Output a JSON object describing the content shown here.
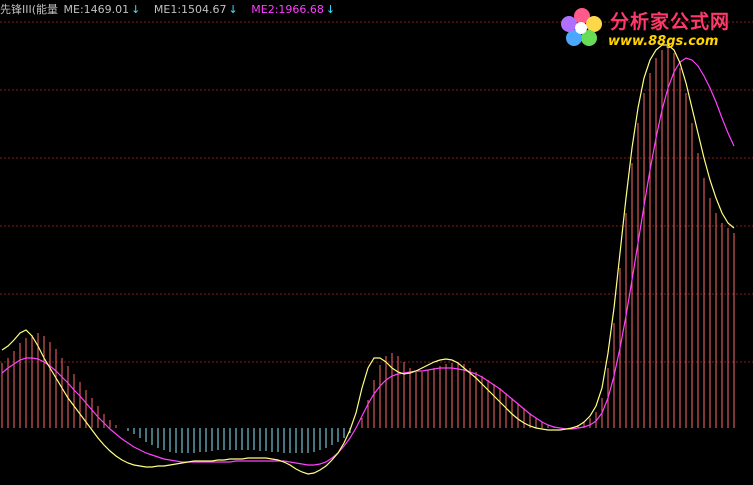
{
  "header": {
    "indicator_name": "先锋III(能量",
    "me_label": "ME:1469.01",
    "me1_label": "ME1:1504.67",
    "me2_label": "ME2:1966.68",
    "arrow": "↓"
  },
  "logo": {
    "title": "分析家公式网",
    "url": "www.88gs.com",
    "icon": "flower-icon"
  },
  "colors": {
    "background": "#000000",
    "grid": "#8a1c1c",
    "bar_positive": "#ff6a6a",
    "bar_negative": "#8fe8ff",
    "line_me1": "#ffff80",
    "line_me2": "#ff40ff"
  },
  "chart_data": {
    "type": "bar",
    "zero_line": 0,
    "grid": true,
    "bars_description": "histogram ME per period, positive red, negative cyan",
    "bars": [
      65,
      70,
      77,
      85,
      90,
      93,
      95,
      92,
      86,
      79,
      70,
      62,
      54,
      46,
      38,
      30,
      22,
      14,
      8,
      3,
      0,
      -3,
      -6,
      -10,
      -14,
      -17,
      -20,
      -22,
      -24,
      -25,
      -25,
      -25,
      -25,
      -24,
      -24,
      -23,
      -22,
      -22,
      -22,
      -22,
      -22,
      -22,
      -22,
      -23,
      -23,
      -24,
      -24,
      -25,
      -25,
      -25,
      -25,
      -25,
      -24,
      -22,
      -20,
      -17,
      -14,
      -10,
      -5,
      0,
      10,
      28,
      48,
      63,
      72,
      75,
      72,
      66,
      60,
      56,
      56,
      58,
      60,
      62,
      64,
      65,
      66,
      64,
      60,
      56,
      52,
      48,
      44,
      40,
      35,
      30,
      25,
      20,
      15,
      10,
      6,
      3,
      1,
      0,
      0,
      1,
      3,
      6,
      10,
      16,
      30,
      60,
      105,
      160,
      215,
      265,
      305,
      335,
      355,
      370,
      378,
      380,
      375,
      360,
      335,
      305,
      275,
      250,
      230,
      215,
      205,
      200,
      195
    ],
    "series": [
      {
        "name": "ME1",
        "values": [
          78,
          82,
          88,
          95,
          98,
          92,
          82,
          70,
          60,
          50,
          40,
          30,
          22,
          14,
          6,
          -2,
          -10,
          -17,
          -23,
          -28,
          -32,
          -35,
          -37,
          -38,
          -39,
          -39,
          -38,
          -38,
          -37,
          -36,
          -35,
          -34,
          -33,
          -33,
          -33,
          -33,
          -32,
          -32,
          -31,
          -31,
          -31,
          -30,
          -30,
          -30,
          -30,
          -31,
          -32,
          -34,
          -37,
          -41,
          -44,
          -46,
          -45,
          -42,
          -38,
          -32,
          -25,
          -15,
          -2,
          15,
          40,
          60,
          70,
          70,
          66,
          60,
          56,
          54,
          55,
          57,
          60,
          63,
          66,
          68,
          69,
          68,
          65,
          60,
          55,
          50,
          44,
          38,
          32,
          26,
          20,
          14,
          9,
          5,
          2,
          0,
          -1,
          -2,
          -2,
          -2,
          -1,
          0,
          2,
          6,
          12,
          22,
          40,
          75,
          120,
          175,
          230,
          280,
          320,
          350,
          368,
          378,
          383,
          383,
          378,
          365,
          345,
          320,
          295,
          270,
          248,
          230,
          215,
          205,
          200
        ]
      },
      {
        "name": "ME2",
        "values": [
          55,
          60,
          64,
          68,
          70,
          70,
          69,
          66,
          62,
          57,
          51,
          45,
          38,
          32,
          25,
          18,
          11,
          5,
          -1,
          -6,
          -11,
          -15,
          -19,
          -22,
          -25,
          -27,
          -29,
          -31,
          -32,
          -33,
          -34,
          -34,
          -34,
          -34,
          -34,
          -34,
          -34,
          -34,
          -34,
          -33,
          -33,
          -33,
          -33,
          -33,
          -33,
          -33,
          -33,
          -33,
          -34,
          -35,
          -36,
          -37,
          -37,
          -36,
          -34,
          -30,
          -25,
          -18,
          -10,
          0,
          12,
          24,
          34,
          42,
          48,
          52,
          54,
          55,
          56,
          57,
          57,
          58,
          59,
          60,
          60,
          60,
          59,
          58,
          56,
          54,
          51,
          47,
          43,
          39,
          34,
          29,
          24,
          19,
          14,
          10,
          6,
          3,
          1,
          0,
          -1,
          -1,
          0,
          1,
          3,
          7,
          15,
          30,
          52,
          80,
          112,
          148,
          185,
          222,
          258,
          290,
          318,
          340,
          356,
          366,
          370,
          368,
          362,
          352,
          340,
          326,
          310,
          295,
          282
        ]
      }
    ]
  }
}
